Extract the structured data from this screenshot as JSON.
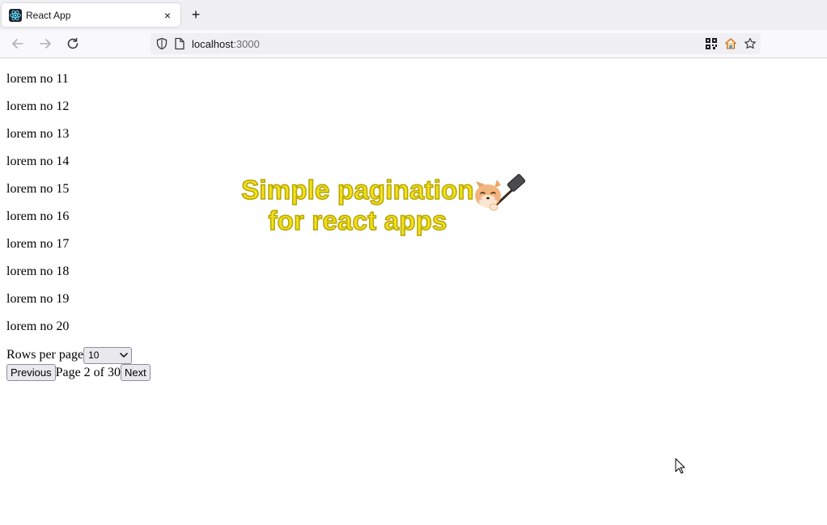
{
  "browser": {
    "tab_title": "React App",
    "tab_close_glyph": "×",
    "new_tab_glyph": "+",
    "url_host": "localhost",
    "url_port": ":3000",
    "favicon_icon": "react-logo-icon"
  },
  "page": {
    "items": [
      "lorem no 11",
      "lorem no 12",
      "lorem no 13",
      "lorem no 14",
      "lorem no 15",
      "lorem no 16",
      "lorem no 17",
      "lorem no 18",
      "lorem no 19",
      "lorem no 20"
    ],
    "rows_per_page_label": "Rows per page",
    "rows_per_page_value": "10",
    "previous_label": "Previous",
    "page_status": "Page 2 of 30",
    "next_label": "Next"
  },
  "overlay": {
    "line1": "Simple pagination",
    "line2": "for react apps",
    "colors": {
      "fill": "#f0e21c",
      "stroke": "#b8a400"
    }
  }
}
